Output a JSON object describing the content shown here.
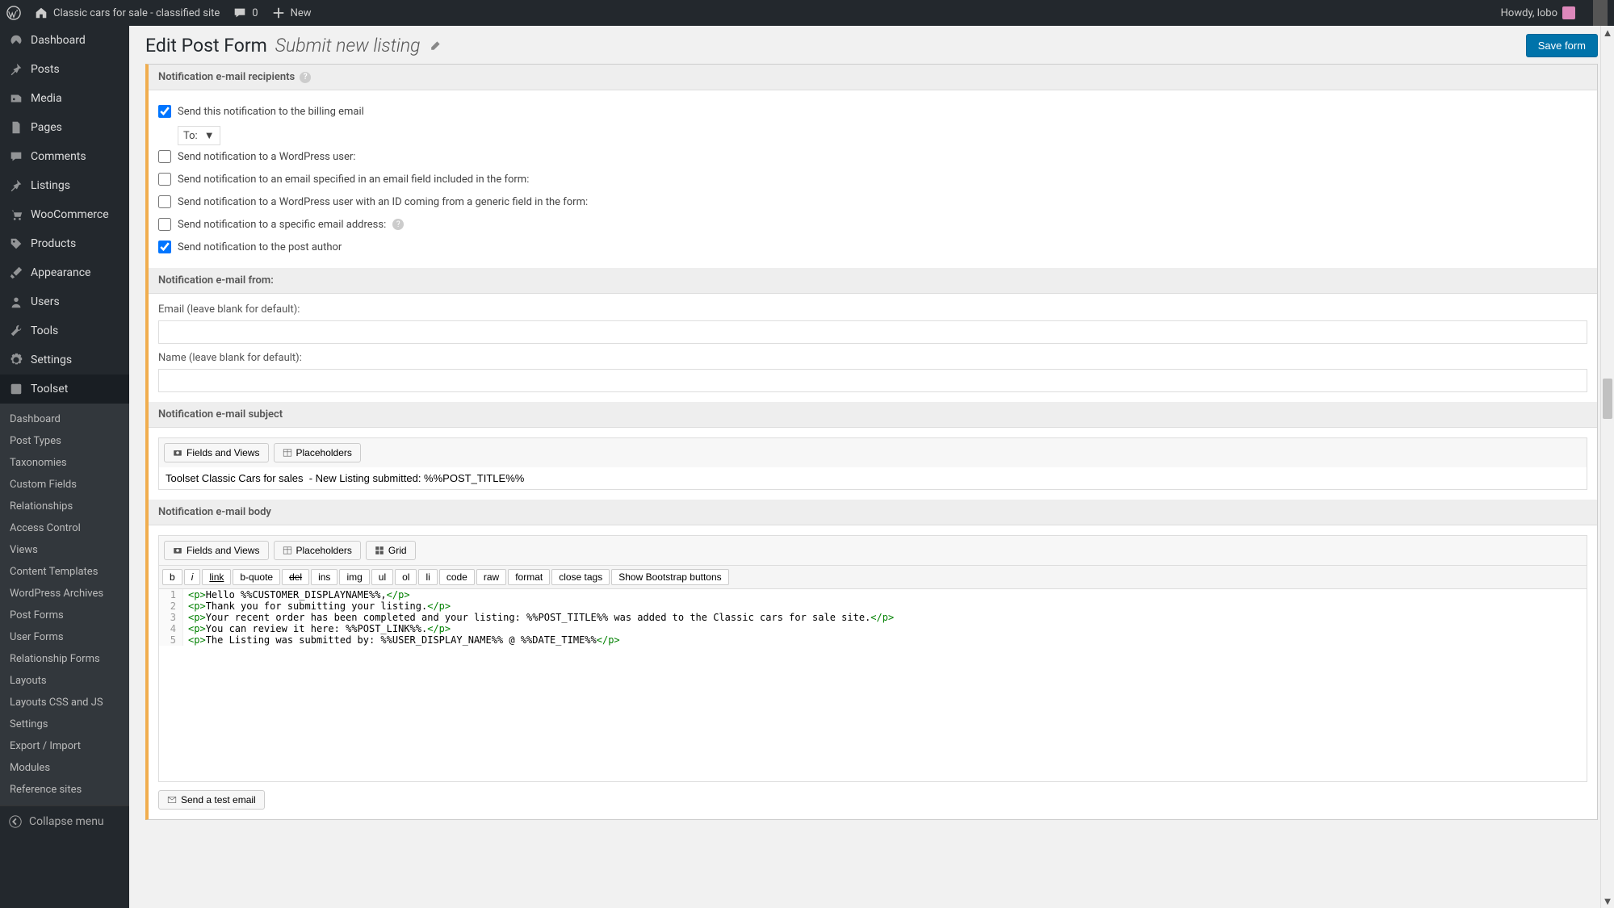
{
  "adminbar": {
    "site_name": "Classic cars for sale - classified site",
    "comments_count": "0",
    "new_label": "New",
    "howdy": "Howdy, lobo"
  },
  "sidebar_items": [
    {
      "icon": "dashboard",
      "label": "Dashboard"
    },
    {
      "icon": "pin",
      "label": "Posts"
    },
    {
      "icon": "media",
      "label": "Media"
    },
    {
      "icon": "page",
      "label": "Pages"
    },
    {
      "icon": "comment",
      "label": "Comments"
    },
    {
      "icon": "pin",
      "label": "Listings"
    },
    {
      "icon": "cart",
      "label": "WooCommerce"
    },
    {
      "icon": "tag",
      "label": "Products"
    },
    {
      "icon": "brush",
      "label": "Appearance"
    },
    {
      "icon": "user",
      "label": "Users"
    },
    {
      "icon": "wrench",
      "label": "Tools"
    },
    {
      "icon": "gear",
      "label": "Settings"
    }
  ],
  "toolset": {
    "label": "Toolset",
    "submenu": [
      "Dashboard",
      "Post Types",
      "Taxonomies",
      "Custom Fields",
      "Relationships",
      "Access Control",
      "Views",
      "Content Templates",
      "WordPress Archives",
      "Post Forms",
      "User Forms",
      "Relationship Forms",
      "Layouts",
      "Layouts CSS and JS",
      "Settings",
      "Export / Import",
      "Modules",
      "Reference sites"
    ]
  },
  "collapse_label": "Collapse menu",
  "page": {
    "title": "Edit Post Form",
    "subtitle": "Submit new listing",
    "save_btn": "Save form"
  },
  "recipients": {
    "header": "Notification e-mail recipients",
    "billing": {
      "label": "Send this notification to the billing email",
      "checked": true
    },
    "to_label": "To:",
    "wp_user": {
      "label": "Send notification to a WordPress user:",
      "checked": false
    },
    "email_field": {
      "label": "Send notification to an email specified in an email field included in the form:",
      "checked": false
    },
    "wp_user_id": {
      "label": "Send notification to a WordPress user with an ID coming from a generic field in the form:",
      "checked": false
    },
    "specific": {
      "label": "Send notification to a specific email address:",
      "checked": false
    },
    "author": {
      "label": "Send notification to the post author",
      "checked": true
    }
  },
  "from": {
    "header": "Notification e-mail from:",
    "email_label": "Email (leave blank for default):",
    "email_value": "",
    "name_label": "Name (leave blank for default):",
    "name_value": ""
  },
  "subject": {
    "header": "Notification e-mail subject",
    "fields_views": "Fields and Views",
    "placeholders": "Placeholders",
    "value": "Toolset Classic Cars for sales  - New Listing submitted: %%POST_TITLE%%"
  },
  "body": {
    "header": "Notification e-mail body",
    "fields_views": "Fields and Views",
    "placeholders": "Placeholders",
    "grid": "Grid",
    "qt": [
      "b",
      "i",
      "link",
      "b-quote",
      "del",
      "ins",
      "img",
      "ul",
      "ol",
      "li",
      "code",
      "raw",
      "format",
      "close tags",
      "Show Bootstrap buttons"
    ],
    "lines": [
      {
        "n": "1",
        "open": "<p>",
        "text": "Hello %%CUSTOMER_DISPLAYNAME%%,",
        "close": "</p>"
      },
      {
        "n": "2",
        "open": "<p>",
        "text": "Thank you for submitting your listing.",
        "close": "</p>"
      },
      {
        "n": "3",
        "open": "<p>",
        "text": "Your recent order has been completed and your listing: %%POST_TITLE%% was added to the Classic cars for sale site.",
        "close": "</p>"
      },
      {
        "n": "4",
        "open": "<p>",
        "text": "You can review it here: %%POST_LINK%%.",
        "close": "</p>"
      },
      {
        "n": "5",
        "open": "<p>",
        "text": "The Listing was submitted by: %%USER_DISPLAY_NAME%% @ %%DATE_TIME%%",
        "close": "</p>"
      }
    ],
    "test_email": "Send a test email"
  }
}
